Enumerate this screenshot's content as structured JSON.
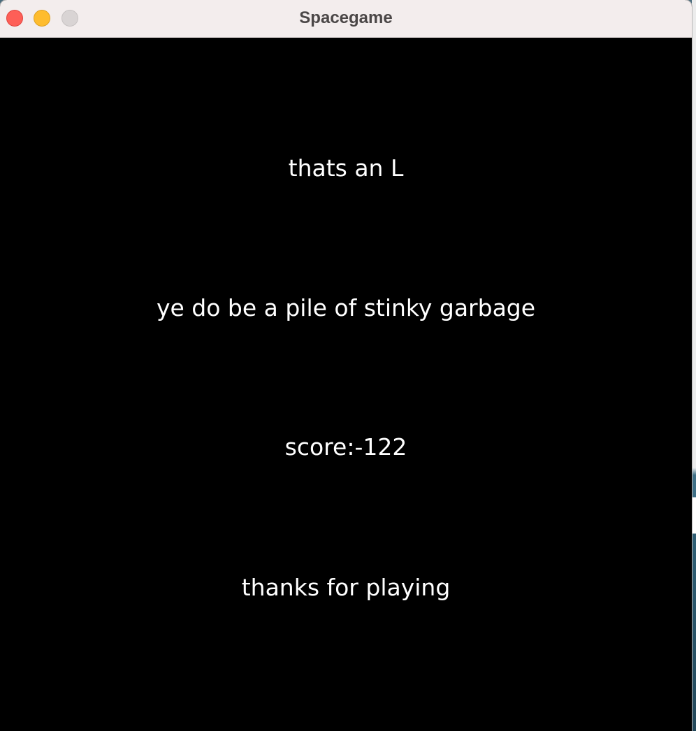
{
  "window": {
    "title": "Spacegame"
  },
  "game_over": {
    "line1": "thats an L",
    "line2": "ye do be a pile of stinky garbage",
    "score_text": "score:-122",
    "closing": "thanks for playing"
  },
  "colors": {
    "background": "#000000",
    "text": "#ffffff",
    "titlebar": "#f3eded",
    "close": "#fe5f57",
    "minimize": "#febc2e",
    "zoom": "#d9d4d4"
  }
}
